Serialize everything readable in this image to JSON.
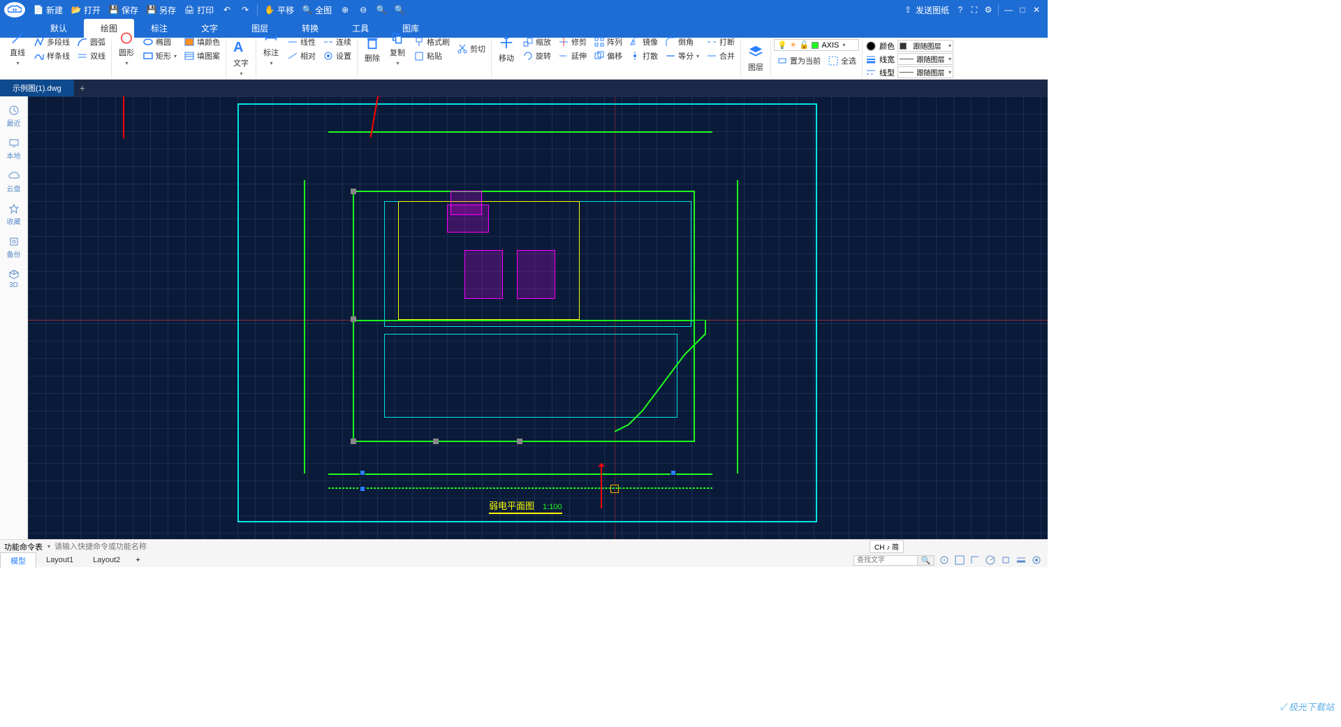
{
  "titlebar": {
    "new": "新建",
    "open": "打开",
    "save": "保存",
    "saveas": "另存",
    "print": "打印",
    "pan": "平移",
    "full": "全图",
    "send": "发送图纸"
  },
  "menu": {
    "tabs": [
      "默认",
      "绘图",
      "标注",
      "文字",
      "图层",
      "转换",
      "工具",
      "图库"
    ]
  },
  "ribbon": {
    "line": "直线",
    "polyline": "多段线",
    "arc": "圆弧",
    "spline": "样条线",
    "xline": "双线",
    "circle": "圆形",
    "ellipse": "椭圆",
    "rect": "矩形",
    "fill": "填颜色",
    "hatch": "填图案",
    "text": "文字",
    "dim": "标注",
    "linear": "线性",
    "continue": "连续",
    "align": "相对",
    "settings": "设置",
    "delete": "删除",
    "format": "格式刷",
    "copy": "复制",
    "cut": "剪切",
    "paste": "粘贴",
    "move": "移动",
    "scale": "缩放",
    "trim": "修剪",
    "rotate": "旋转",
    "extend": "延伸",
    "array": "阵列",
    "mirror": "镜像",
    "offset": "偏移",
    "explode": "打散",
    "chamfer": "倒角",
    "equal": "等分",
    "break": "打断",
    "join": "合并",
    "layer": "图层",
    "layer_name": "AXIS",
    "setcurrent": "置为当前",
    "selectall": "全选",
    "color": "颜色",
    "lineweight": "线宽",
    "linetype": "线型",
    "bylayer": "跟随图层"
  },
  "filetab": {
    "name": "示例图(1).dwg"
  },
  "sidebar": {
    "recent": "最近",
    "local": "本地",
    "cloud": "云盘",
    "fav": "收藏",
    "backup": "备份",
    "three_d": "3D"
  },
  "drawing": {
    "title": "弱电平面图",
    "scale": "1:100"
  },
  "cmdbar": {
    "label": "功能命令表",
    "placeholder": "请输入快捷命令或功能名称",
    "ime": "CH ♪ 简"
  },
  "layouts": {
    "model": "模型",
    "l1": "Layout1",
    "l2": "Layout2"
  },
  "search": {
    "placeholder": "查找文字"
  },
  "watermark": "极光下载站"
}
